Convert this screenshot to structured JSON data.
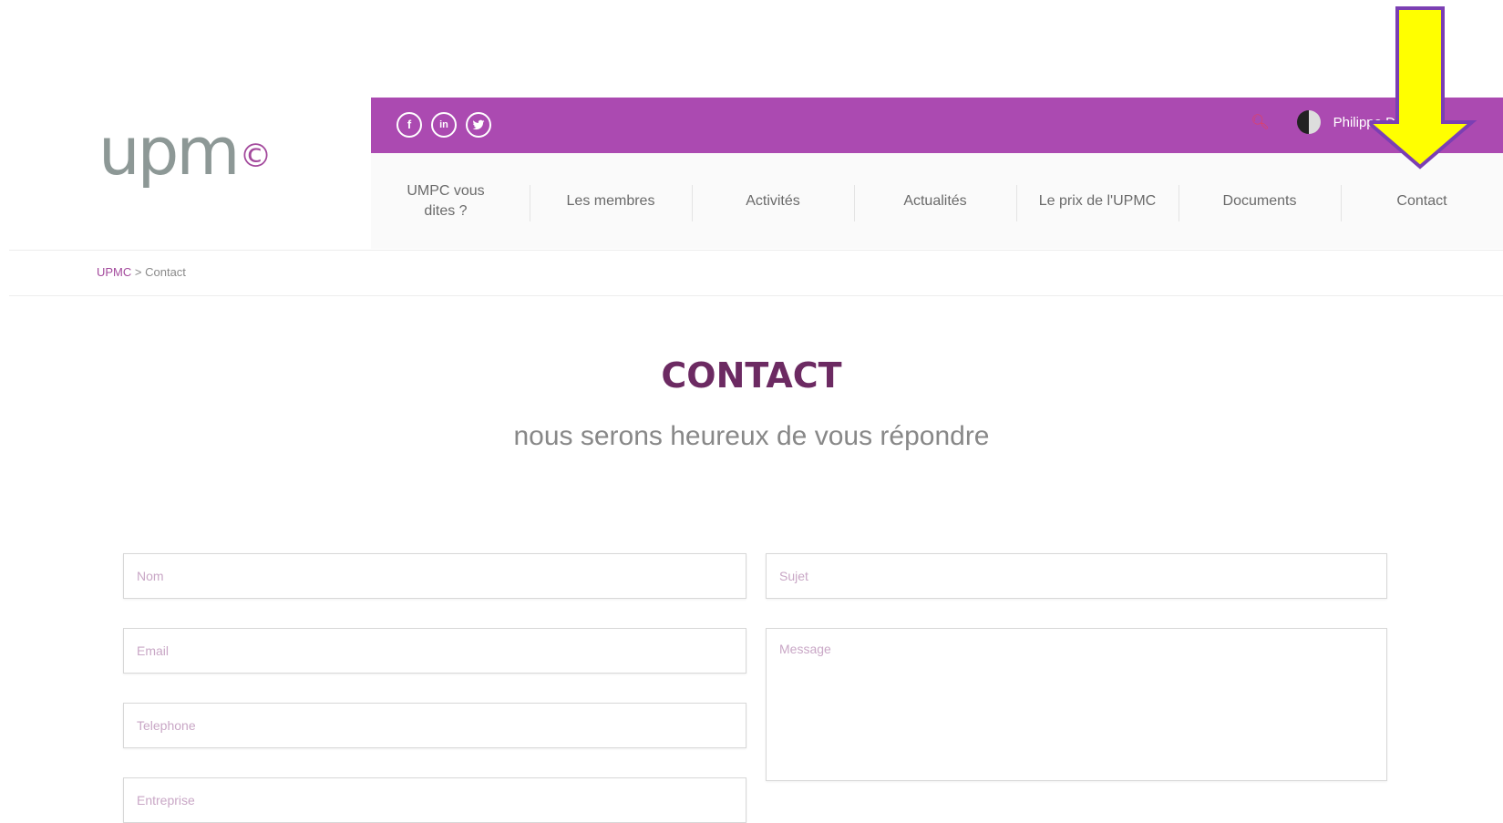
{
  "logo": {
    "text": "upm",
    "mark": "©"
  },
  "topbar": {
    "social": [
      {
        "icon": "facebook-icon",
        "glyph": "f"
      },
      {
        "icon": "linkedin-icon",
        "glyph": "in"
      },
      {
        "icon": "twitter-icon",
        "glyph": "🐦"
      }
    ],
    "user_name": "Philippe D"
  },
  "nav": {
    "items": [
      {
        "label": "UMPC vous dites ?"
      },
      {
        "label": "Les membres"
      },
      {
        "label": "Activités"
      },
      {
        "label": "Actualités"
      },
      {
        "label": "Le prix de l'UPMC"
      },
      {
        "label": "Documents"
      },
      {
        "label": "Contact"
      }
    ]
  },
  "breadcrumb": {
    "home": "UPMC",
    "separator": " > ",
    "current": "Contact"
  },
  "page": {
    "title": "CONTACT",
    "subtitle": "nous serons heureux de vous répondre"
  },
  "form": {
    "nom_placeholder": "Nom",
    "sujet_placeholder": "Sujet",
    "email_placeholder": "Email",
    "message_placeholder": "Message",
    "telephone_placeholder": "Telephone",
    "entreprise_placeholder": "Entreprise"
  },
  "colors": {
    "brand_purple": "#ab4ab1",
    "title_purple": "#6c2a62",
    "arrow_yellow": "#ffff00",
    "arrow_outline": "#7b3fb3"
  }
}
